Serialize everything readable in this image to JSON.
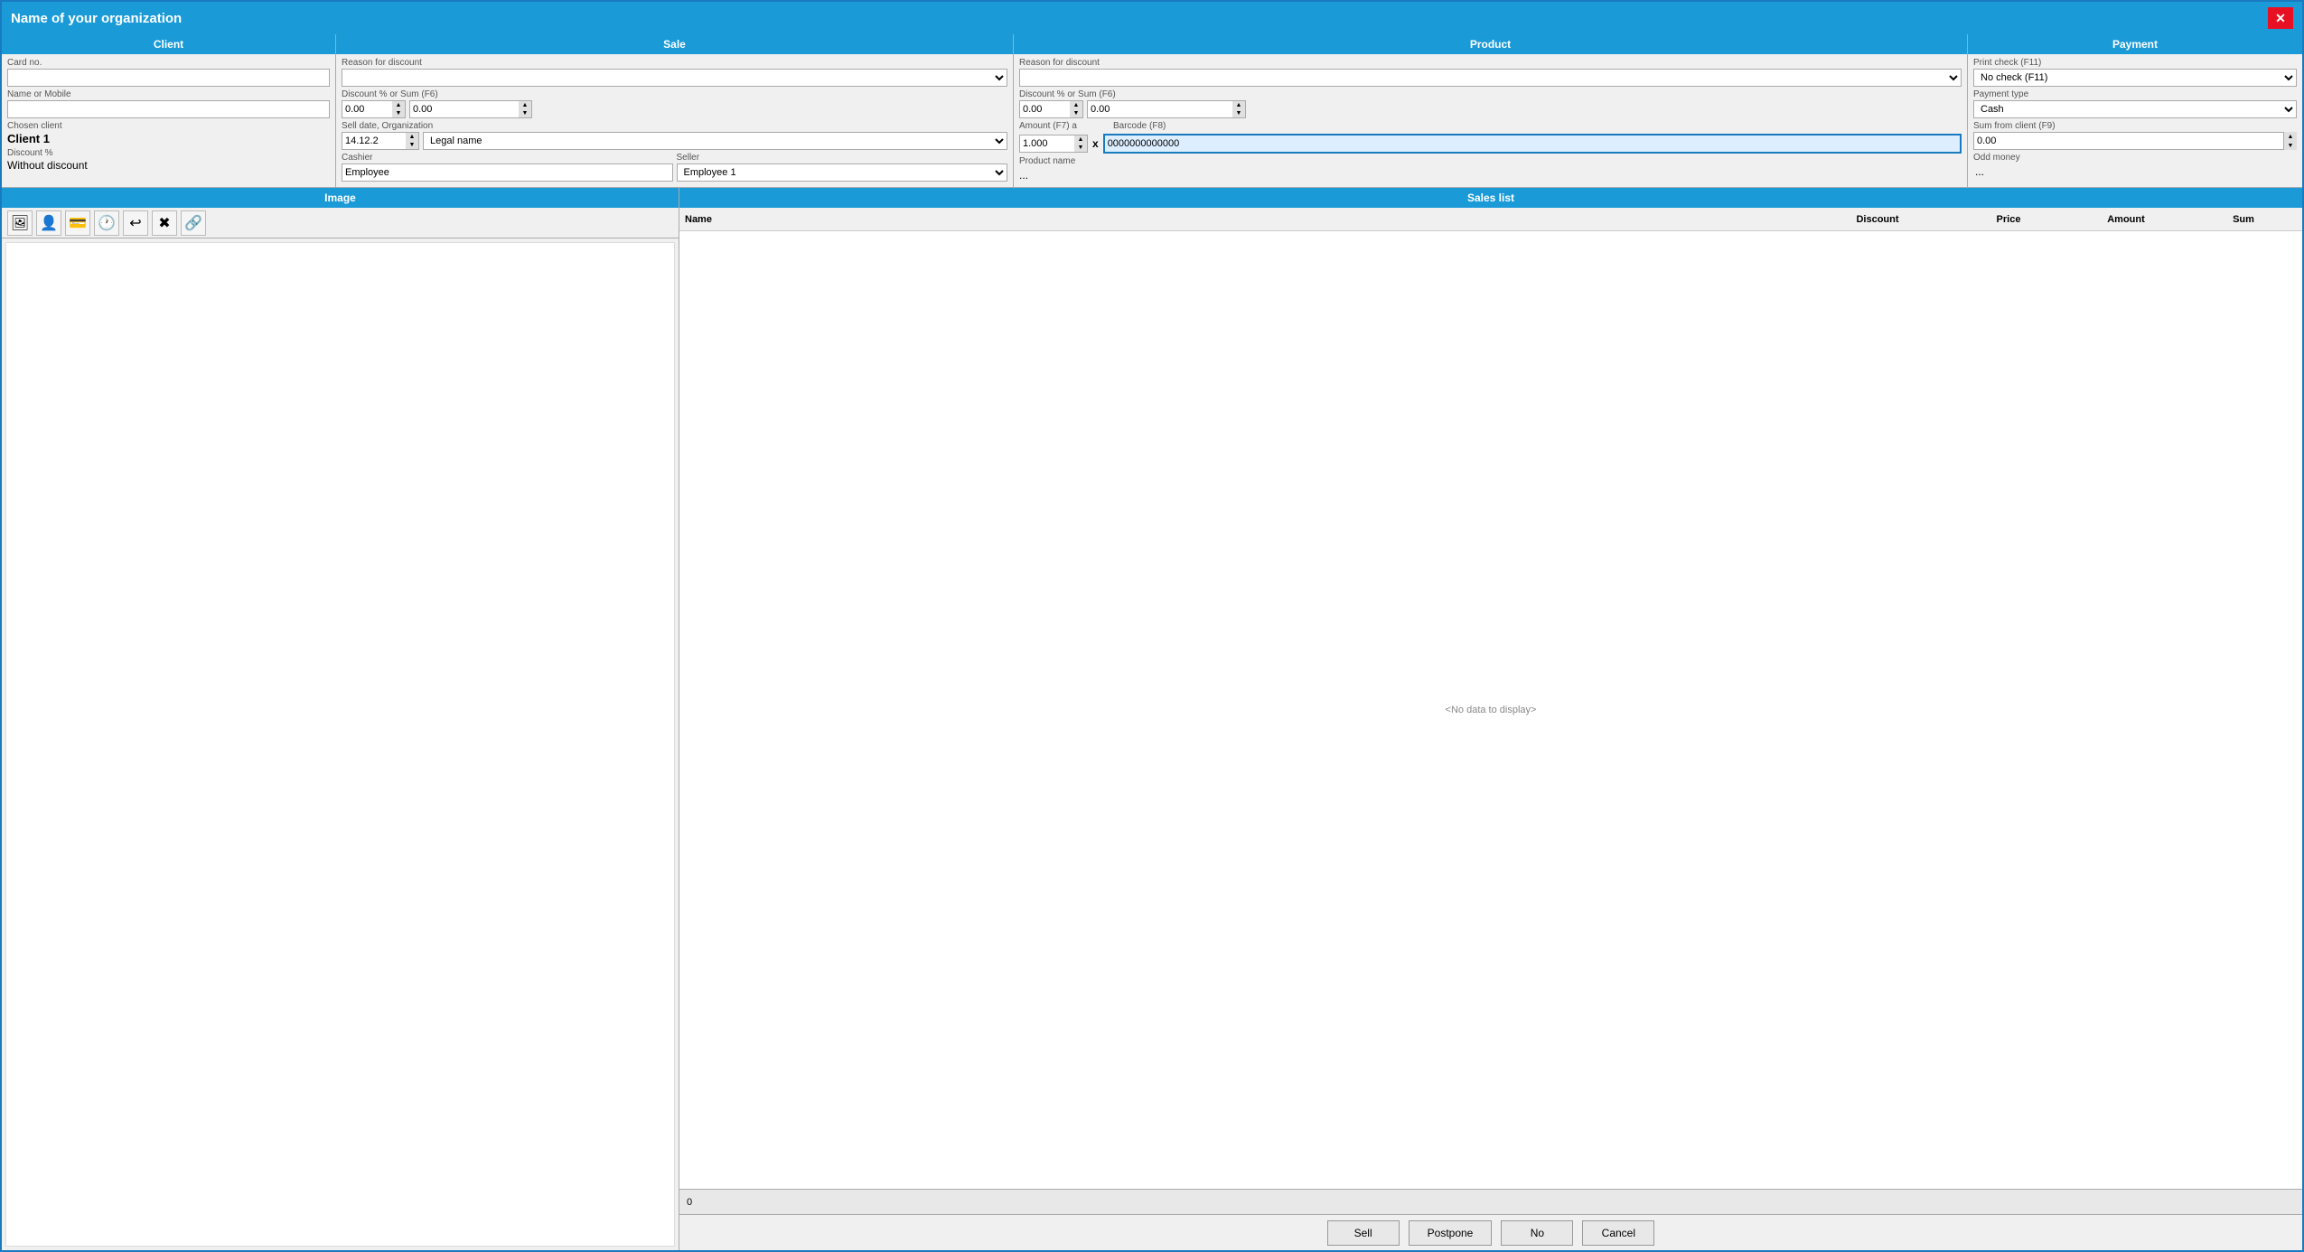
{
  "window": {
    "title": "Name of your organization",
    "close_label": "✕"
  },
  "sections": {
    "client": "Client",
    "sale": "Sale",
    "product": "Product",
    "payment": "Payment",
    "image": "Image",
    "sales_list": "Sales list"
  },
  "client": {
    "card_no_label": "Card no.",
    "card_no_value": "",
    "name_mobile_label": "Name or Mobile",
    "name_mobile_value": "",
    "chosen_client_label": "Chosen client",
    "chosen_client_value": "Client 1",
    "discount_pct_label": "Discount %",
    "discount_pct_value": "Without discount"
  },
  "sale": {
    "reason_discount_label": "Reason for discount",
    "reason_discount_value": "",
    "discount_pct_label": "Discount % or Sum (F6)",
    "discount_val1": "0.00",
    "discount_val2": "0.00",
    "sell_date_label": "Sell date, Organization",
    "sell_date_value": "14.12.2",
    "organization_label": "Legal name",
    "cashier_label": "Cashier",
    "cashier_value": "Employee",
    "seller_label": "Seller",
    "seller_value": "Employee 1"
  },
  "product": {
    "reason_discount_label": "Reason for discount",
    "reason_discount_value": "",
    "discount_pct_label": "Discount % or Sum (F6)",
    "discount_val1": "0.00",
    "discount_val2": "0.00",
    "amount_label": "Amount (F7) a",
    "amount_value": "1.000",
    "barcode_label": "Barcode (F8)",
    "barcode_value": "0000000000000",
    "product_name_label": "Product name",
    "product_name_value": "..."
  },
  "payment": {
    "print_check_label": "Print check (F11)",
    "print_check_value": "No check (F11)",
    "payment_type_label": "Payment type",
    "payment_type_value": "Cash",
    "sum_from_client_label": "Sum from client (F9)",
    "sum_from_client_value": "0.00",
    "odd_money_label": "Odd money",
    "odd_money_value": "..."
  },
  "sales_list": {
    "columns": {
      "name": "Name",
      "discount": "Discount",
      "price": "Price",
      "amount": "Amount",
      "sum": "Sum"
    },
    "no_data": "<No data to display>",
    "total": "0"
  },
  "toolbar": {
    "icons": [
      "🖼",
      "👤",
      "💳",
      "🕐",
      "↩",
      "✖",
      "🔗"
    ]
  },
  "actions": {
    "sell": "Sell",
    "postpone": "Postpone",
    "no": "No",
    "cancel": "Cancel"
  }
}
